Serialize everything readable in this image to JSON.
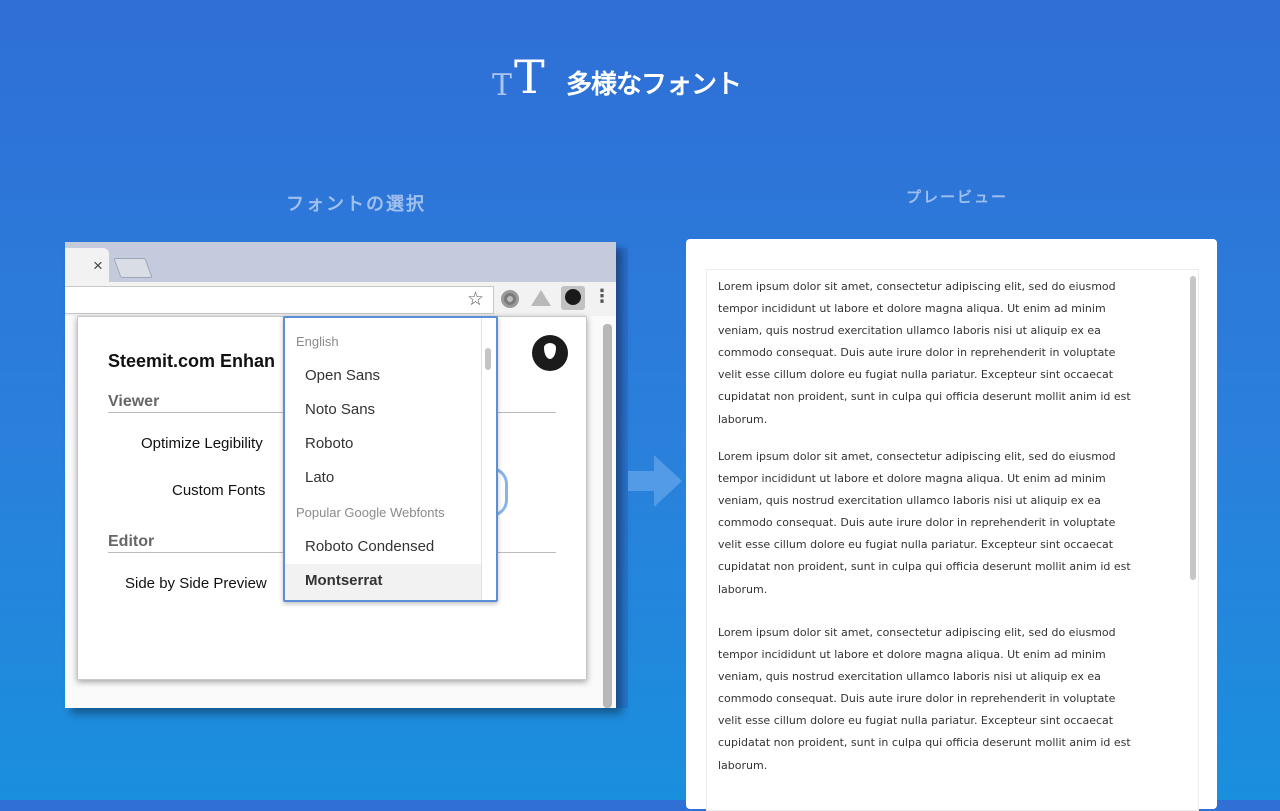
{
  "header": {
    "logo_small": "T",
    "logo_big": "T",
    "title": "多様なフォント"
  },
  "labels": {
    "left": "フォントの選択",
    "right": "プレービュー"
  },
  "browser": {
    "tab_close": "×",
    "star": "☆",
    "menu": "⋮"
  },
  "popup": {
    "title": "Steemit.com Enhan",
    "sections": [
      {
        "heading": "Viewer",
        "options": [
          "Optimize Legibility",
          "Custom Fonts"
        ]
      },
      {
        "heading": "Editor",
        "options": [
          "Side by Side Preview"
        ]
      }
    ]
  },
  "dropdown": {
    "groups": [
      {
        "label": "English",
        "items": [
          "Open Sans",
          "Noto Sans",
          "Roboto",
          "Lato"
        ]
      },
      {
        "label": "Popular Google Webfonts",
        "items": [
          "Roboto Condensed",
          "Montserrat"
        ]
      }
    ],
    "selected": "Montserrat"
  },
  "preview": {
    "paragraph_lines": [
      "Lorem ipsum dolor sit amet, consectetur adipiscing elit, sed do eiusmod",
      "tempor incididunt ut labore et dolore magna aliqua. Ut enim ad minim",
      "veniam, quis nostrud exercitation ullamco laboris nisi ut aliquip ex ea",
      "commodo consequat. Duis aute irure dolor in reprehenderit in voluptate",
      "velit esse cillum dolore eu fugiat nulla pariatur. Excepteur sint occaecat",
      "cupidatat non proident, sunt in culpa qui officia deserunt mollit anim id est",
      "laborum."
    ],
    "paragraph_count": 3
  },
  "colors": {
    "background_top": "#2f6fd6",
    "background_bottom": "#1a8fdc",
    "accent": "#5d8fd6"
  }
}
